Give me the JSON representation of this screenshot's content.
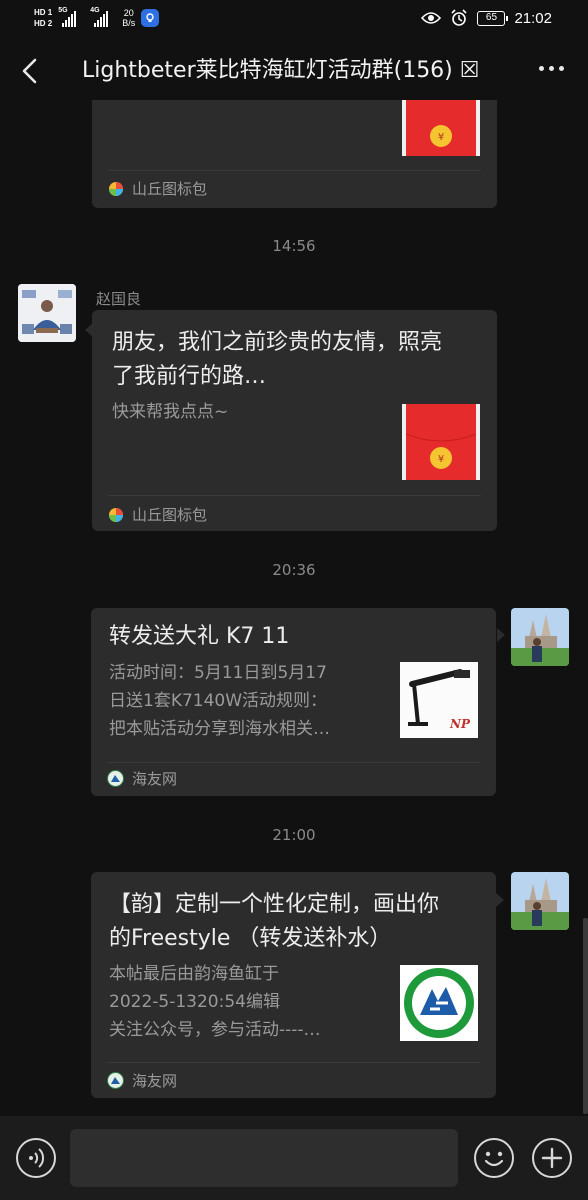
{
  "status_bar": {
    "sim1": "HD 1",
    "sim2": "HD 2",
    "network1": "5G",
    "network2": "4G",
    "speed_value": "20",
    "speed_unit": "B/s",
    "battery": "65",
    "time": "21:02"
  },
  "header": {
    "title": "Lightbeter莱比特海缸灯活动群(156) ☒"
  },
  "messages": {
    "m0": {
      "source": "山丘图标包"
    },
    "t1": "14:56",
    "m1": {
      "sender": "赵国良",
      "title": "朋友，我们之前珍贵的友情，照亮了我前行的路…",
      "title_line1": "朋友，我们之前珍贵的友情，照亮",
      "title_line2": "了我前行的路…",
      "desc": "快来帮我点点~",
      "source": "山丘图标包"
    },
    "t2": "20:36",
    "m2": {
      "title": "转发送大礼 K7 11",
      "desc_line1": "活动时间：5月11日到5月17",
      "desc_line2": "日送1套K7140W活动规则：",
      "desc_line3": "把本贴活动分享到海水相关…",
      "source": "海友网"
    },
    "t3": "21:00",
    "m3": {
      "title_line1": "【韵】定制一个性化定制，画出你",
      "title_line2": "的Freestyle （转发送补水）",
      "desc_line1": "本帖最后由韵海鱼缸于",
      "desc_line2": "2022-5-1320:54编辑",
      "desc_line3": "关注公众号，参与活动----…",
      "source": "海友网"
    }
  },
  "colors": {
    "background": "#111111",
    "bubble": "#2c2c2c",
    "red_packet": "#e52b2b",
    "coin": "#f5c431"
  },
  "icons": [
    "back-icon",
    "more-icon",
    "eye-icon",
    "alarm-icon",
    "voice-icon",
    "emoji-icon",
    "plus-icon"
  ]
}
